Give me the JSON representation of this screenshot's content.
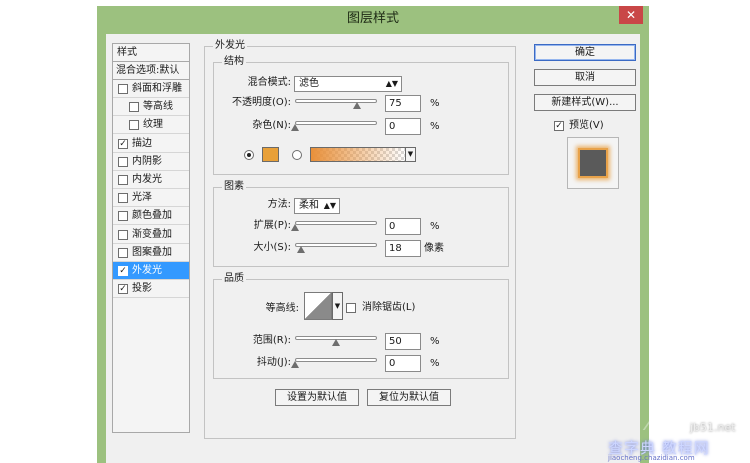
{
  "window": {
    "title": "图层样式",
    "close_glyph": "✕"
  },
  "styles_list": {
    "header": "样式",
    "blend_options": "混合选项:默认",
    "items": [
      {
        "label": "斜面和浮雕",
        "checked": false,
        "indent": false
      },
      {
        "label": "等高线",
        "checked": false,
        "indent": true
      },
      {
        "label": "纹理",
        "checked": false,
        "indent": true
      },
      {
        "label": "描边",
        "checked": true,
        "indent": false
      },
      {
        "label": "内阴影",
        "checked": false,
        "indent": false
      },
      {
        "label": "内发光",
        "checked": false,
        "indent": false
      },
      {
        "label": "光泽",
        "checked": false,
        "indent": false
      },
      {
        "label": "颜色叠加",
        "checked": false,
        "indent": false
      },
      {
        "label": "渐变叠加",
        "checked": false,
        "indent": false
      },
      {
        "label": "图案叠加",
        "checked": false,
        "indent": false
      },
      {
        "label": "外发光",
        "checked": true,
        "indent": false,
        "selected": true
      },
      {
        "label": "投影",
        "checked": true,
        "indent": false
      }
    ]
  },
  "outer_glow": {
    "title": "外发光",
    "structure": {
      "title": "结构",
      "blend_mode_label": "混合模式:",
      "blend_mode_value": "滤色",
      "opacity_label": "不透明度(O):",
      "opacity_value": "75",
      "opacity_fraction": 0.75,
      "noise_label": "杂色(N):",
      "noise_value": "0",
      "noise_fraction": 0,
      "percent": "%",
      "glow_color": "#e8a038"
    },
    "elements": {
      "title": "图素",
      "technique_label": "方法:",
      "technique_value": "柔和",
      "spread_label": "扩展(P):",
      "spread_value": "0",
      "spread_fraction": 0,
      "size_label": "大小(S):",
      "size_value": "18",
      "size_fraction": 0.07,
      "size_unit": "像素",
      "percent": "%"
    },
    "quality": {
      "title": "品质",
      "contour_label": "等高线:",
      "antialias_label": "消除锯齿(L)",
      "antialias_checked": false,
      "range_label": "范围(R):",
      "range_value": "50",
      "range_fraction": 0.5,
      "jitter_label": "抖动(J):",
      "jitter_value": "0",
      "jitter_fraction": 0,
      "percent": "%"
    },
    "buttons": {
      "make_default": "设置为默认值",
      "reset_default": "复位为默认值"
    }
  },
  "right_panel": {
    "ok": "确定",
    "cancel": "取消",
    "new_style": "新建样式(W)...",
    "preview_label": "预览(V)",
    "preview_checked": true
  },
  "watermark": {
    "site": "jb51.net",
    "main": "查字典 教程网",
    "url": "jiaocheng.chazidian.com"
  }
}
